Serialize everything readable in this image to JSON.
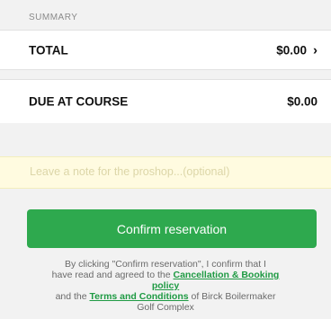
{
  "summary": {
    "section_title": "SUMMARY",
    "total_label": "TOTAL",
    "total_value": "$0.00",
    "total_chevron": "›",
    "due_label": "DUE AT COURSE",
    "due_value": "$0.00"
  },
  "note": {
    "placeholder": "Leave a note for the proshop...(optional)"
  },
  "confirm": {
    "button_label": "Confirm reservation"
  },
  "legal": {
    "line1": "By clicking \"Confirm reservation\", I confirm that I",
    "line2_prefix": "have read and agreed to the ",
    "cancellation_link": "Cancellation & Booking",
    "line3_link_cont": "policy",
    "line4_prefix": "and the ",
    "terms_link": "Terms and Conditions",
    "line4_suffix": " of Birck Boilermaker",
    "line5": "Golf Complex"
  },
  "colors": {
    "accent_green": "#2ea94e",
    "link_green": "#1e9a43",
    "note_background": "#fffbe0"
  }
}
